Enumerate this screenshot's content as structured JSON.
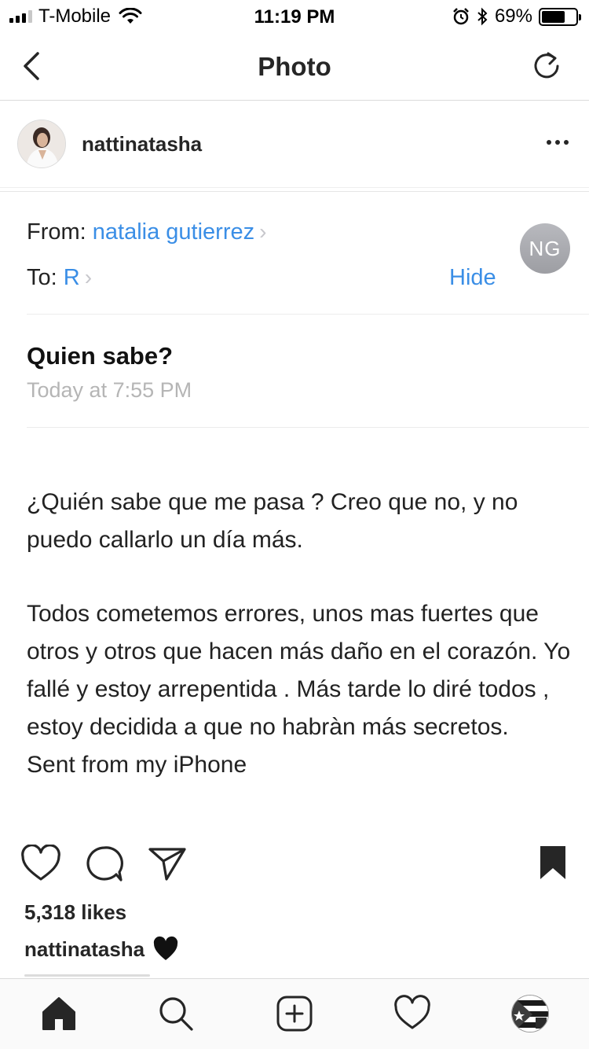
{
  "status_bar": {
    "carrier": "T-Mobile",
    "time": "11:19 PM",
    "battery_pct_text": "69%",
    "battery_level": 0.69
  },
  "nav": {
    "title": "Photo",
    "back_icon": "chevron-left-icon",
    "refresh_icon": "refresh-icon"
  },
  "post": {
    "username": "nattinatasha",
    "more_icon": "more-dots-icon"
  },
  "email": {
    "from_label": "From:",
    "from_name": "natalia gutierrez",
    "to_label": "To:",
    "to_name": "R",
    "hide_label": "Hide",
    "avatar_initials": "NG",
    "subject": "Quien sabe?",
    "date": "Today at 7:55 PM",
    "paragraph_1": "¿Quién sabe que me pasa ? Creo que no, y no puedo callarlo un día más.",
    "paragraph_2": "Todos cometemos errores, unos mas fuertes que otros y otros que hacen más daño en el corazón. Yo fallé y estoy arrepentida . Más tarde lo diré todos , estoy decidida a que no habràn más secretos.",
    "signature": "Sent from my iPhone"
  },
  "engagement": {
    "likes": "5,318 likes",
    "caption_user": "nattinatasha",
    "caption_emoji": "black-heart-icon"
  },
  "tab_bar": {
    "items": [
      "home-icon",
      "search-icon",
      "new-post-icon",
      "activity-heart-icon",
      "profile-avatar"
    ]
  },
  "colors": {
    "link_blue": "#3a8ee6",
    "text": "#262626",
    "muted": "#b5b5b5"
  }
}
